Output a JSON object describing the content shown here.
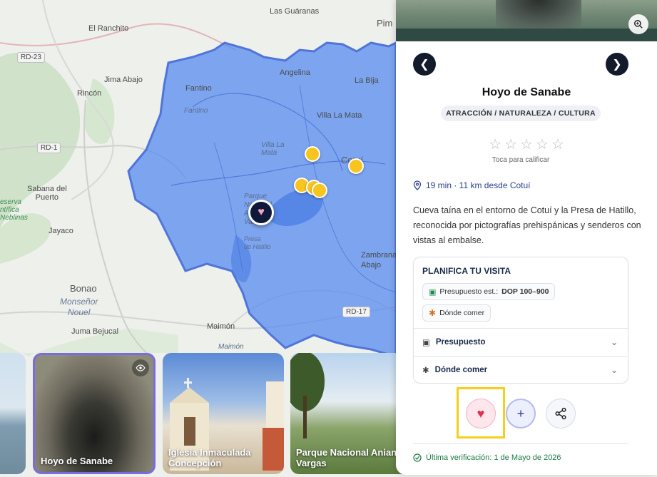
{
  "map": {
    "labels": {
      "las_guaranas": "Las Guáranas",
      "pim": "Pim",
      "el_ranchito": "El Ranchito",
      "jima_abajo": "Jima Abajo",
      "rincon": "Rincón",
      "fantino": "Fantino",
      "fantino_area": "Fantino",
      "angelina": "Angelina",
      "la_bija": "La Bija",
      "villa_la_mata": "Villa La Mata",
      "la_mata_area": "Villa La Mata",
      "cotui": "Cotuí",
      "sabana_del_puerto": "Sabana del\nPuerto",
      "reserva": "eserva\nntífica\nNeblinas",
      "jayaco": "Jayaco",
      "parque_area": "Parque\nNacional\nAniana\nVargas",
      "presa": "Presa\nde Hatillo",
      "zambrana": "Zambrana\nAbajo",
      "bonao": "Bonao",
      "monsenor": "Monseñor\nNouel",
      "juma_bejucal": "Juma Bejucal",
      "maimon": "Maimón",
      "maimon_area": "Maimón"
    },
    "roads": {
      "rd23": "RD-23",
      "rd1": "RD-1",
      "rd17": "RD-17"
    },
    "poi_color": "#f7c51e",
    "region_color": "#5d8ff0"
  },
  "carousel": [
    {
      "title": "",
      "active": false
    },
    {
      "title": "Hoyo de Sanabe",
      "active": true
    },
    {
      "title": "Iglesia Inmaculada Concepción",
      "active": false
    },
    {
      "title": "Parque Nacional Aniana Vargas",
      "active": false
    }
  ],
  "panel": {
    "title": "Hoyo de Sanabe",
    "category": "ATRACCIÓN / NATURALEZA / CULTURA",
    "rating_hint": "Toca para calificar",
    "distance": "19 min · 11 km desde Cotuí",
    "description": "Cueva taína en el entorno de Cotuí y la Presa de Hatillo, reconocida por pictografías prehispánicas y senderos con vistas al embalse.",
    "plan": {
      "title": "PLANIFICA TU VISITA",
      "budget_label": "Presupuesto est.:",
      "budget_value": "DOP 100–900",
      "food_chip": "Dónde comer",
      "accordion_budget": "Presupuesto",
      "accordion_food": "Dónde comer"
    },
    "verified": "Última verificación: 1 de Mayo de 2026",
    "accent": "#f5cf19"
  }
}
